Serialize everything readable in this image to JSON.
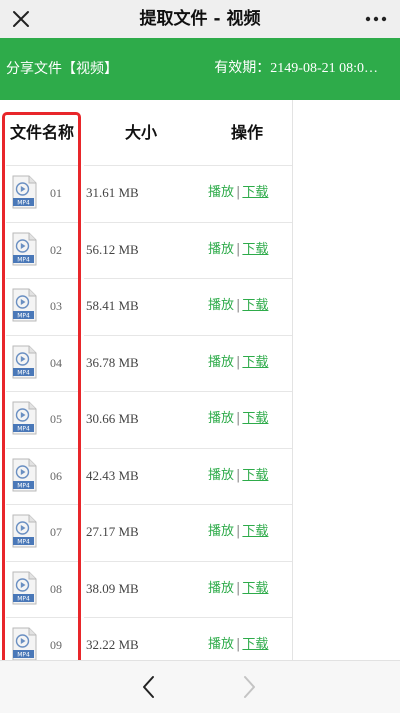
{
  "titlebar": {
    "title": "提取文件 - 视频",
    "close_icon": "close-icon",
    "more_icon": "more-icon"
  },
  "banner": {
    "share_label": "分享文件【视频】",
    "expiry_label": "有效期：2149-08-21 08:0…"
  },
  "table": {
    "headers": {
      "name": "文件名称",
      "size": "大小",
      "ops": "操作"
    },
    "files": [
      {
        "name": "01",
        "size": "31.61 MB",
        "play": "播放",
        "sep": "|",
        "download": "下载",
        "badge": "MP4"
      },
      {
        "name": "02",
        "size": "56.12 MB",
        "play": "播放",
        "sep": "|",
        "download": "下载",
        "badge": "MP4"
      },
      {
        "name": "03",
        "size": "58.41 MB",
        "play": "播放",
        "sep": "|",
        "download": "下载",
        "badge": "MP4"
      },
      {
        "name": "04",
        "size": "36.78 MB",
        "play": "播放",
        "sep": "|",
        "download": "下载",
        "badge": "MP4"
      },
      {
        "name": "05",
        "size": "30.66 MB",
        "play": "播放",
        "sep": "|",
        "download": "下载",
        "badge": "MP4"
      },
      {
        "name": "06",
        "size": "42.43 MB",
        "play": "播放",
        "sep": "|",
        "download": "下载",
        "badge": "MP4"
      },
      {
        "name": "07",
        "size": "27.17 MB",
        "play": "播放",
        "sep": "|",
        "download": "下载",
        "badge": "MP4"
      },
      {
        "name": "08",
        "size": "38.09 MB",
        "play": "播放",
        "sep": "|",
        "download": "下载",
        "badge": "MP4"
      },
      {
        "name": "09",
        "size": "32.22 MB",
        "play": "播放",
        "sep": "|",
        "download": "下载",
        "badge": "MP4"
      }
    ]
  },
  "colors": {
    "accent": "#2eab4a",
    "highlight": "#e8262a"
  },
  "bottombar": {
    "back_icon": "chevron-left-icon",
    "forward_icon": "chevron-right-icon"
  }
}
